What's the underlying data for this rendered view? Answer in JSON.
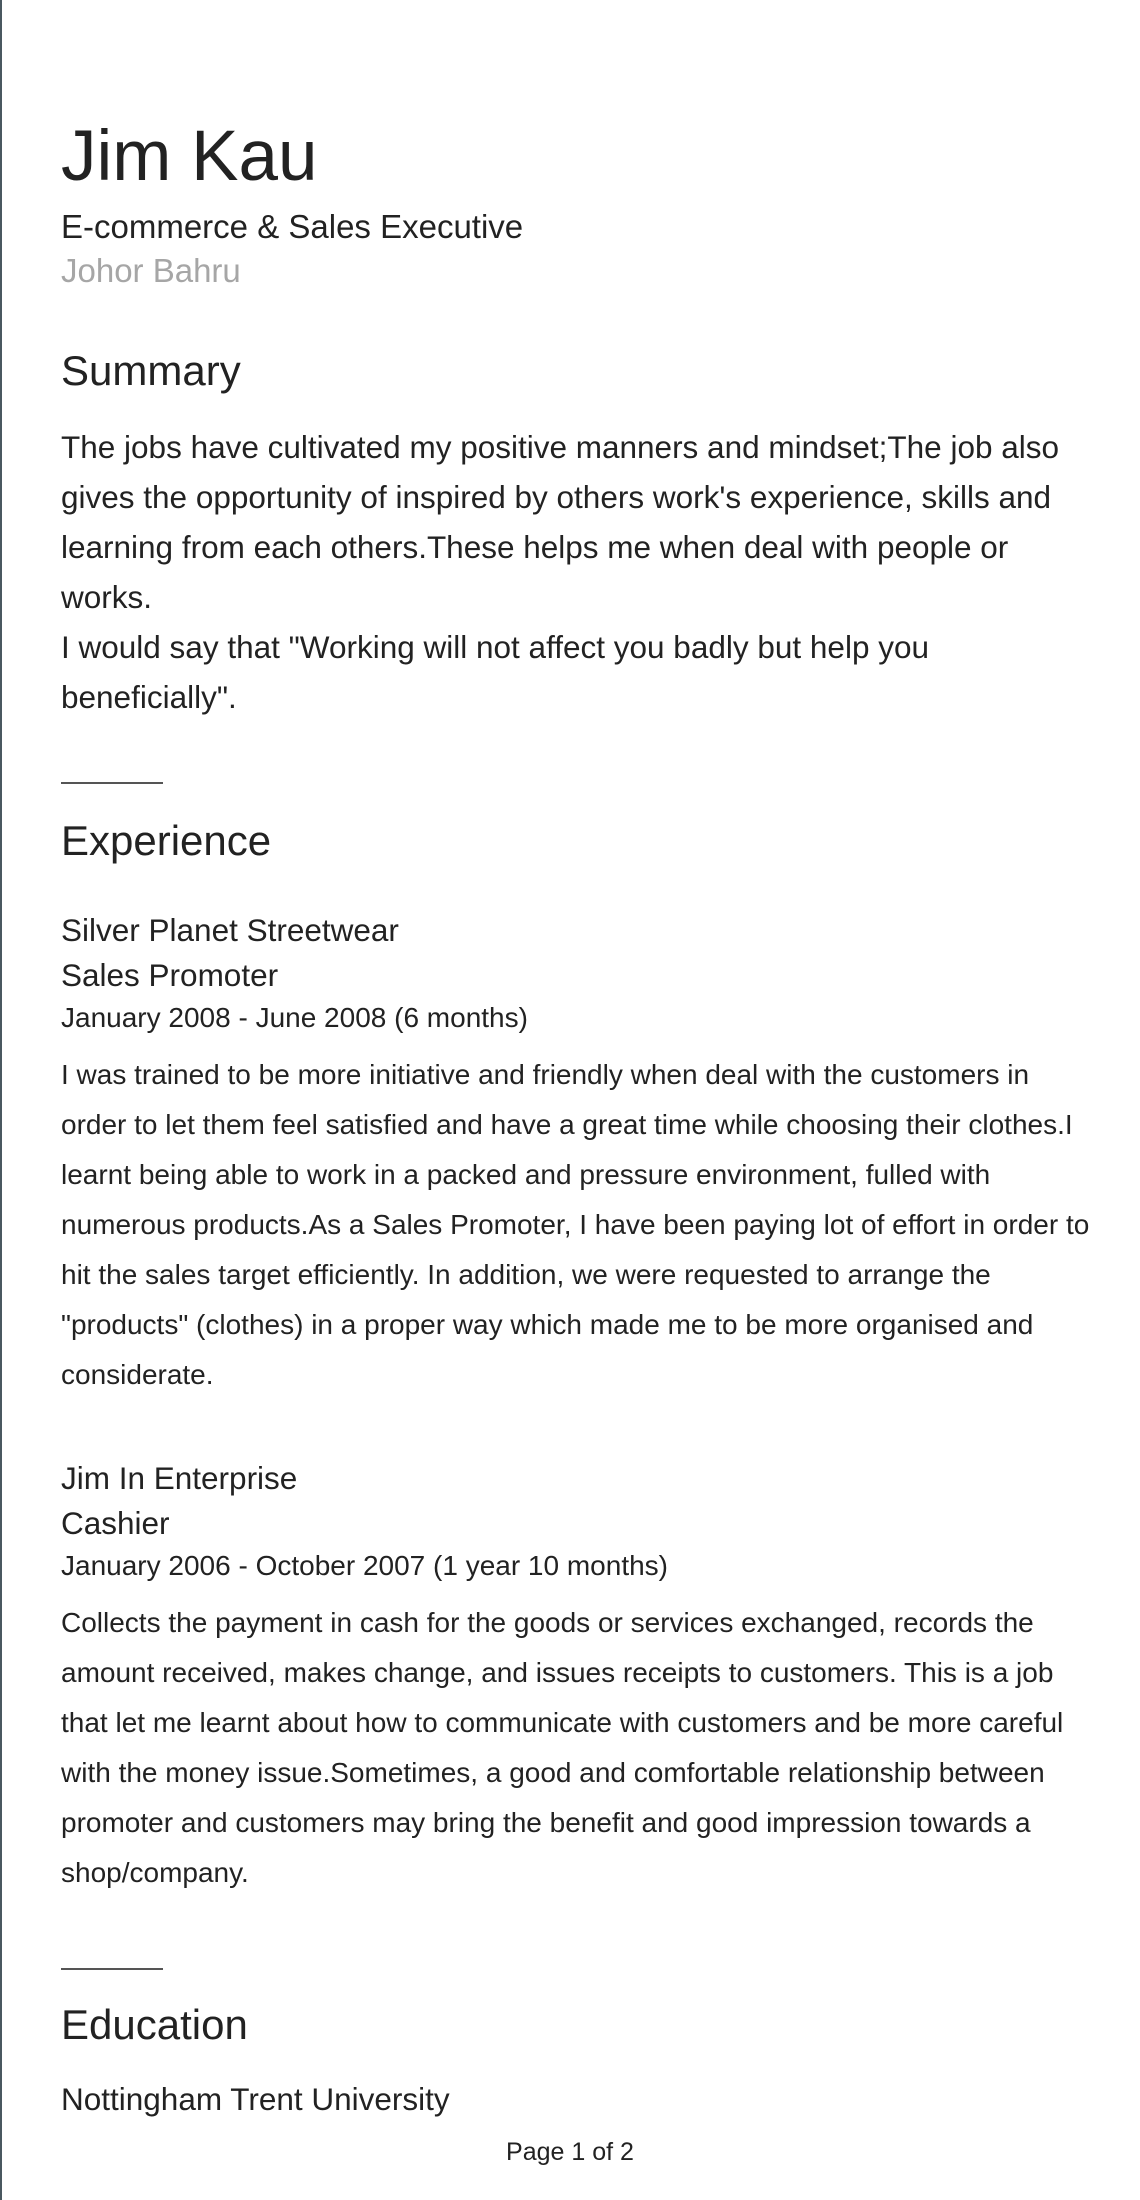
{
  "profile": {
    "name": "Jim Kau",
    "headline": "E-commerce & Sales Executive",
    "location": "Johor Bahru"
  },
  "summary": {
    "title": "Summary",
    "paragraphs": [
      "The jobs have cultivated my positive manners and mindset;The job also gives the opportunity of inspired by others work's experience, skills and learning from each others.These helps me when deal with people or works.",
      "I would say that \"Working will not affect you badly but help you beneficially\"."
    ]
  },
  "experience": {
    "title": "Experience",
    "jobs": [
      {
        "company": "Silver Planet Streetwear",
        "role": "Sales Promoter",
        "dates": "January 2008 - June 2008 (6 months)",
        "description": "I was trained to be more initiative and friendly when deal with the customers in order to let them feel satisfied and have a great time while choosing their clothes.I learnt being able to work in a packed and pressure environment, fulled with numerous products.As a Sales Promoter, I have been paying lot of effort in order to hit the sales target efficiently. In addition, we were requested to arrange the \"products\" (clothes) in a proper way which made me to be more organised and considerate."
      },
      {
        "company": "Jim In Enterprise",
        "role": "Cashier",
        "dates": "January 2006 - October 2007 (1 year 10 months)",
        "description": "Collects the payment in cash for the goods or services exchanged, records the amount received, makes change, and issues receipts to customers. This is a job that let me learnt about how to communicate with customers and be more careful with the money issue.Sometimes, a good and comfortable relationship between promoter and customers may bring the benefit and good impression towards a shop/company."
      }
    ]
  },
  "education": {
    "title": "Education",
    "schools": [
      {
        "name": "Nottingham Trent University"
      }
    ]
  },
  "footer": {
    "page_label": "Page 1 of 2"
  }
}
